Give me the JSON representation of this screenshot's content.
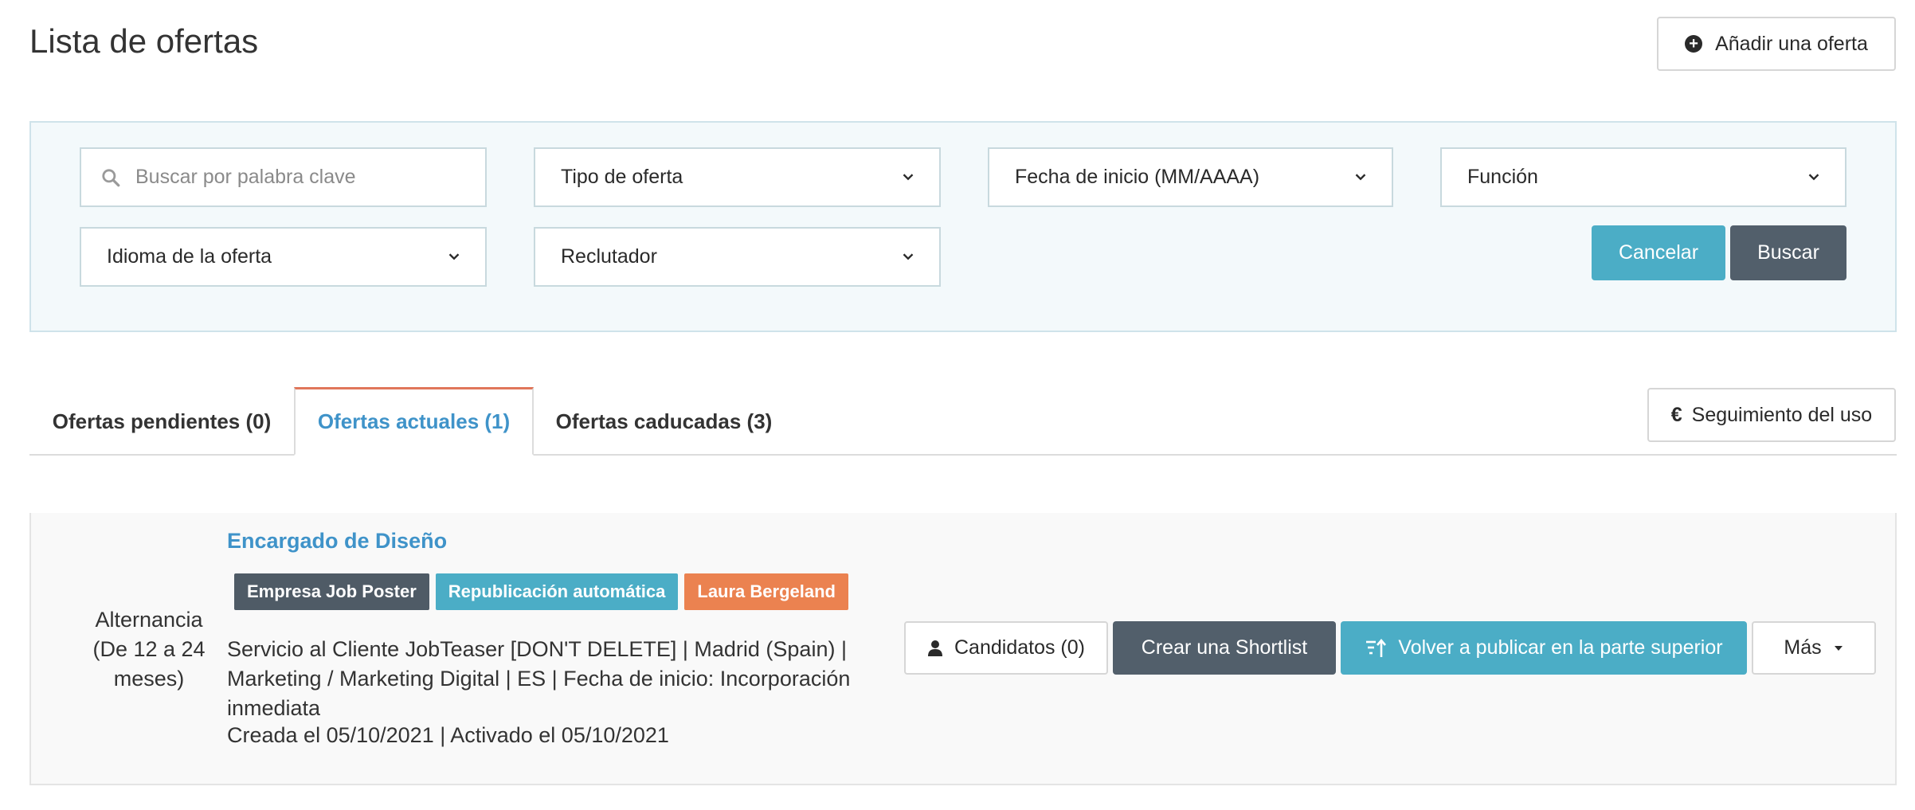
{
  "page": {
    "title": "Lista de ofertas"
  },
  "header": {
    "add_offer_label": "Añadir una oferta"
  },
  "filters": {
    "search_placeholder": "Buscar por palabra clave",
    "offer_type": "Tipo de oferta",
    "start_date": "Fecha de inicio (MM/AAAA)",
    "function": "Función",
    "language": "Idioma de la oferta",
    "recruiter": "Reclutador",
    "cancel_label": "Cancelar",
    "search_label": "Buscar"
  },
  "tabs": [
    {
      "label": "Ofertas pendientes (0)"
    },
    {
      "label": "Ofertas actuales (1)"
    },
    {
      "label": "Ofertas caducadas (3)"
    }
  ],
  "usage_label": "Seguimiento del uso",
  "usage_icon": "€",
  "offer": {
    "type_line1": "Alternancia",
    "type_line2": "(De 12 a 24",
    "type_line3": "meses)",
    "title": "Encargado de Diseño",
    "badges": [
      {
        "label": "Empresa Job Poster",
        "color": "#4f5b66"
      },
      {
        "label": "Republicación automática",
        "color": "#4badc6"
      },
      {
        "label": "Laura Bergeland",
        "color": "#eb8250"
      }
    ],
    "details": "Servicio al Cliente JobTeaser [DON'T DELETE] | Madrid (Spain) | Marketing / Marketing Digital | ES | Fecha de inicio: Incorporación inmediata",
    "dates": "Creada el 05/10/2021 | Activado el 05/10/2021",
    "actions": {
      "candidates": "Candidatos (0)",
      "shortlist": "Crear una Shortlist",
      "republish": "Volver a publicar en la parte superior",
      "more": "Más"
    }
  },
  "colors": {
    "accent_blue": "#3f93c9",
    "teal": "#4badc6",
    "slate": "#525f6b",
    "tab_border": "#e0765a"
  }
}
